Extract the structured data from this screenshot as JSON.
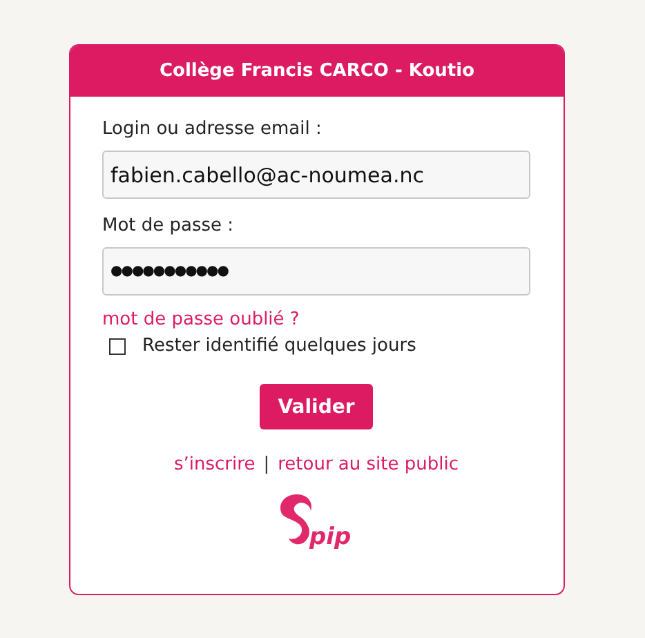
{
  "header": {
    "title": "Collège Francis CARCO - Koutio"
  },
  "login": {
    "label": "Login ou adresse email :",
    "value": "fabien.cabello@ac-noumea.nc"
  },
  "password": {
    "label": "Mot de passe :",
    "value": "●●●●●●●●●●●"
  },
  "forgot_link": "mot de passe oublié ?",
  "remember": {
    "label": "Rester identifié quelques jours",
    "checked": false
  },
  "submit_button": "Valider",
  "footer_links": [
    {
      "label": "s’inscrire"
    },
    {
      "label": "retour au site public"
    }
  ],
  "separator": "|",
  "logo_text": "pip"
}
